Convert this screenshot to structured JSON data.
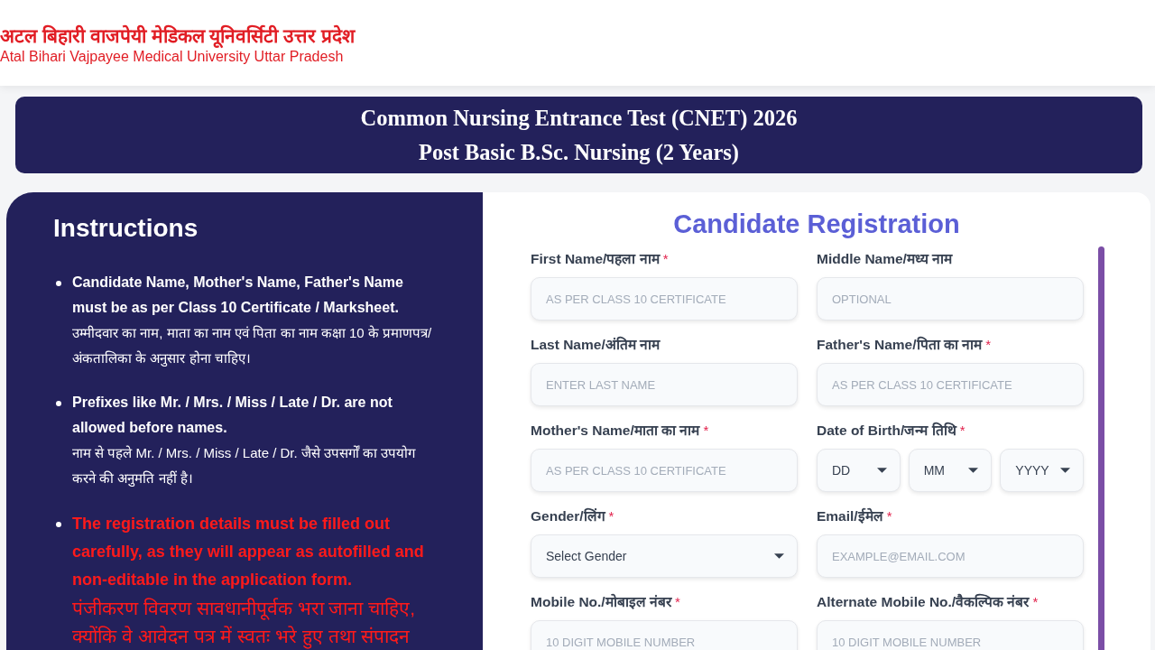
{
  "header": {
    "logo_hindi": "अटल बिहारी वाजपेयी मेडिकल यूनिवर्सिटी उत्तर प्रदेश",
    "logo_english": "Atal Bihari Vajpayee Medical University Uttar Pradesh"
  },
  "banner": {
    "lines": [
      "Common Nursing Entrance Test (CNET) 2026",
      "Post Basic B.Sc. Nursing (2 Years)"
    ]
  },
  "instructions": {
    "title": "Instructions",
    "items": [
      {
        "kind": "note",
        "english": "Candidate Name, Mother's Name, Father's Name must be as per Class 10 Certificate / Marksheet.",
        "hindi": "उम्मीदवार का नाम, माता का नाम एवं पिता का नाम कक्षा 10 के प्रमाणपत्र/ अंकतालिका के अनुसार होना चाहिए।"
      },
      {
        "kind": "note",
        "english": "Prefixes like Mr. / Mrs. / Miss / Late / Dr. are not allowed before names.",
        "hindi": "नाम से पहले Mr. / Mrs. / Miss / Late / Dr. जैसे उपसर्गों का उपयोग करने की अनुमति नहीं है।"
      },
      {
        "kind": "warning",
        "english": "The registration details must be filled out carefully, as they will appear as autofilled and non-editable in the application form.",
        "hindi": "पंजीकरण विवरण सावधानीपूर्वक भरा जाना चाहिए, क्योंकि वे आवेदन पत्र में स्वतः भरे हुए तथा संपादन"
      }
    ]
  },
  "registration": {
    "title": "Candidate Registration",
    "fields": [
      {
        "kind": "text",
        "label": "First Name/पहला नाम",
        "required_mark": "*",
        "placeholder": "AS PER CLASS 10 CERTIFICATE"
      },
      {
        "kind": "text",
        "label": "Middle Name/मध्य नाम",
        "placeholder": "OPTIONAL"
      },
      {
        "kind": "text",
        "label": "Last Name/अंतिम नाम",
        "placeholder": "ENTER LAST NAME"
      },
      {
        "kind": "text",
        "label": "Father's Name/पिता का नाम",
        "required_mark": "*",
        "placeholder": "AS PER CLASS 10 CERTIFICATE"
      },
      {
        "kind": "text",
        "label": "Mother's Name/माता का नाम",
        "required_mark": "*",
        "placeholder": "AS PER CLASS 10 CERTIFICATE"
      },
      {
        "kind": "date",
        "label": "Date of Birth/जन्म तिथि",
        "required_mark": "*",
        "parts": [
          {
            "value": "DD"
          },
          {
            "value": "MM"
          },
          {
            "value": "YYYY"
          }
        ]
      },
      {
        "kind": "select",
        "label": "Gender/लिंग",
        "required_mark": "*",
        "value": "Select Gender"
      },
      {
        "kind": "text",
        "label": "Email/ईमेल",
        "required_mark": "*",
        "placeholder": "EXAMPLE@EMAIL.COM"
      },
      {
        "kind": "text",
        "label": "Mobile No./मोबाइल नंबर",
        "required_mark": "*",
        "placeholder": "10 DIGIT MOBILE NUMBER"
      },
      {
        "kind": "text",
        "label": "Alternate Mobile No./वैकल्पिक नंबर",
        "required_mark": "*",
        "placeholder": "10 DIGIT MOBILE NUMBER"
      }
    ]
  }
}
